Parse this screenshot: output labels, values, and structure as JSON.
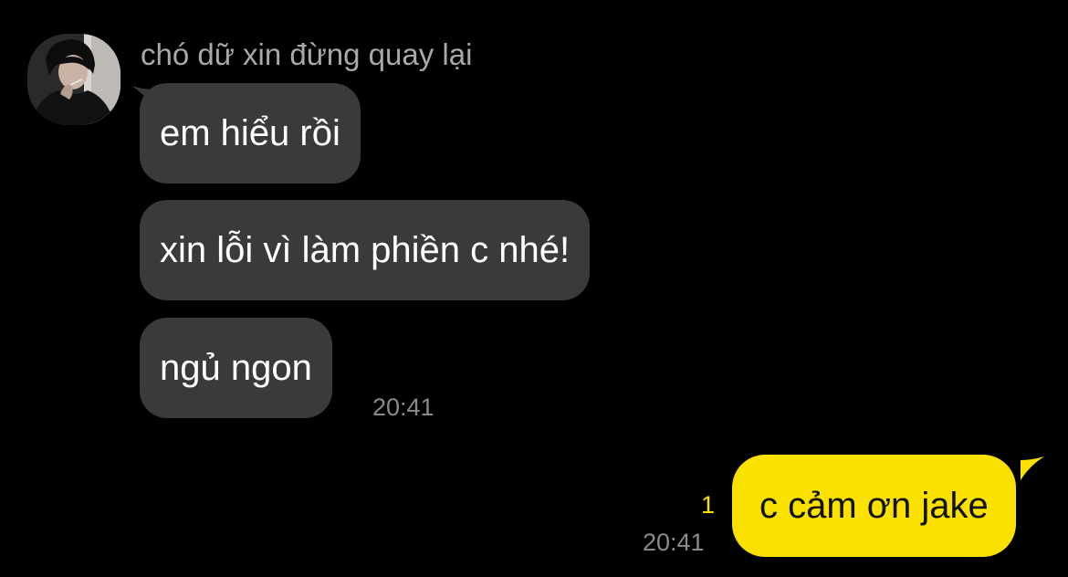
{
  "chat": {
    "sender_name": "chó dữ xin đừng quay lại",
    "avatar_icon": "profile-photo",
    "incoming": [
      {
        "text": "em hiểu rồi"
      },
      {
        "text": "xin lỗi vì làm phiền c nhé!"
      },
      {
        "text": "ngủ ngon"
      }
    ],
    "incoming_time": "20:41",
    "outgoing": {
      "text": "c cảm ơn jake",
      "time": "20:41",
      "unread_count": "1"
    }
  },
  "colors": {
    "background": "#000000",
    "incoming_bubble": "#3a3a3c",
    "outgoing_bubble": "#fae100",
    "timestamp": "#8a8a8a",
    "unread": "#fae100"
  }
}
